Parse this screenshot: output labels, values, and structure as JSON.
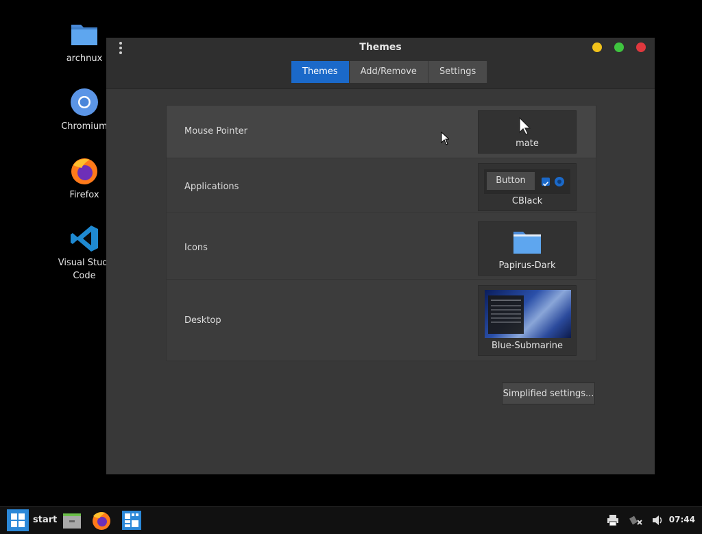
{
  "desktop": {
    "icons": [
      {
        "label": "archnux",
        "icon": "folder-icon"
      },
      {
        "label": "Chromium",
        "icon": "chromium-icon"
      },
      {
        "label": "Firefox",
        "icon": "firefox-icon"
      },
      {
        "label": "Visual Studio Code",
        "label_line1": "Visual Studi",
        "label_line2": "Code",
        "icon": "vscode-icon"
      }
    ]
  },
  "window": {
    "title": "Themes",
    "tabs": [
      {
        "label": "Themes",
        "active": true
      },
      {
        "label": "Add/Remove",
        "active": false
      },
      {
        "label": "Settings",
        "active": false
      }
    ],
    "rows": [
      {
        "label": "Mouse Pointer",
        "value": "mate"
      },
      {
        "label": "Applications",
        "value": "CBlack",
        "sample_button": "Button"
      },
      {
        "label": "Icons",
        "value": "Papirus-Dark"
      },
      {
        "label": "Desktop",
        "value": "Blue-Submarine"
      }
    ],
    "simplified_button": "Simplified settings..."
  },
  "taskbar": {
    "start_label": "start",
    "clock": "07:44"
  },
  "colors": {
    "accent": "#1b69c9",
    "close": "#e0383e",
    "maximize": "#3fc43f",
    "minimize": "#f1c21b",
    "folder": "#5a9ee8"
  }
}
